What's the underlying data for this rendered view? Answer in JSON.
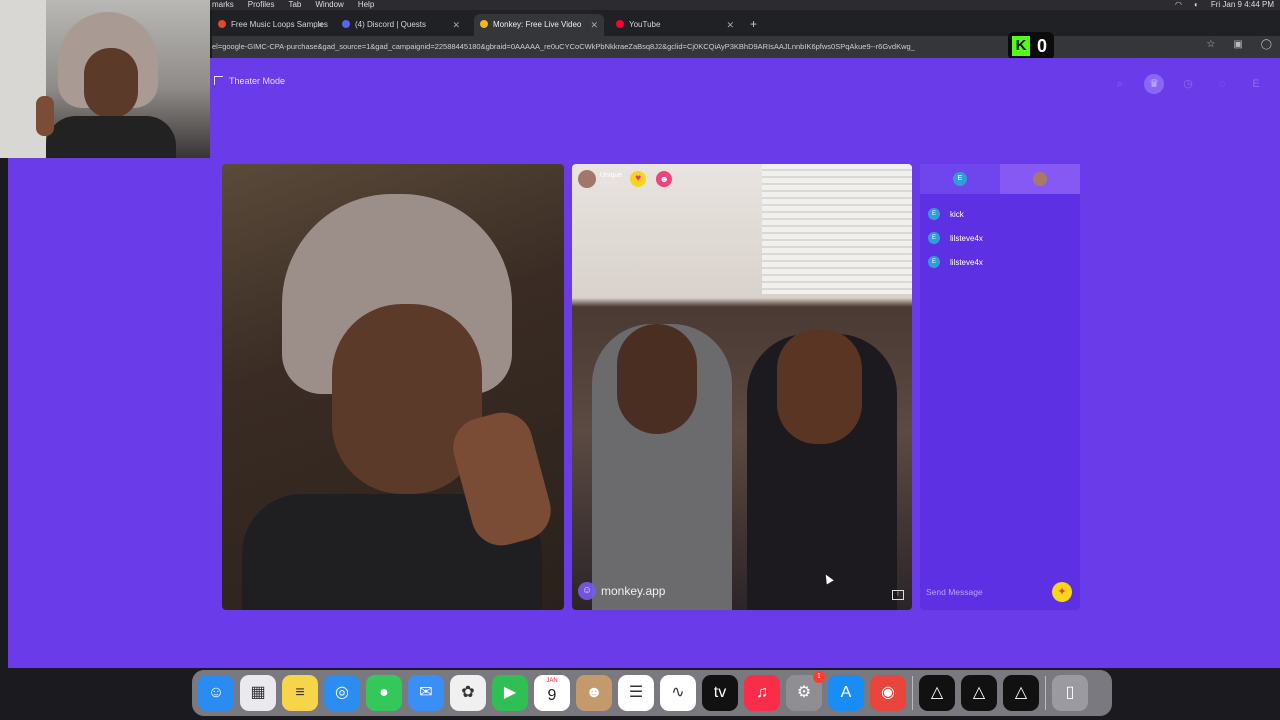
{
  "menubar": {
    "menus": [
      "marks",
      "Profiles",
      "Tab",
      "Window",
      "Help"
    ],
    "clock": "Fri Jan 9  4:44 PM"
  },
  "browser": {
    "tabs": [
      {
        "title": "Free Music Loops Samples S",
        "color": "#e0482f"
      },
      {
        "title": "(4) Discord | Quests",
        "color": "#5865f2"
      },
      {
        "title": "Monkey: Free Live Video",
        "color": "#f2b824"
      },
      {
        "title": "YouTube",
        "color": "#ff0033"
      }
    ],
    "new_tab": "+",
    "url": "el=google-GIMC-CPA-purchase&gad_source=1&gad_campaignid=22588445180&gbraid=0AAAAA_re0uCYCoCWkPbNkkraeZaBsq8J2&gclid=Cj0KCQiAyP3KBhD9ARIsAAJLnnbIK6pfws0SPqAkue9--r6GvdKwg_"
  },
  "kick_overlay": {
    "letter": "K",
    "count": "0"
  },
  "page": {
    "theater_label": "Theater Mode",
    "peer": {
      "name": "Unique",
      "location": "Florida"
    },
    "watermark": "monkey.app",
    "chat": {
      "tab_left_initial": "E",
      "messages": [
        {
          "initial": "E",
          "text": "kick"
        },
        {
          "initial": "E",
          "text": "lilsteve4x"
        },
        {
          "initial": "E",
          "text": "lilsteve4x"
        }
      ],
      "send_placeholder": "Send Message"
    }
  },
  "dock": {
    "items": [
      {
        "name": "finder",
        "glyph": "☺",
        "color": "#2a8cf0"
      },
      {
        "name": "launchpad",
        "glyph": "▦",
        "color": "#e9e9ee"
      },
      {
        "name": "notes",
        "glyph": "≡",
        "color": "#f7d54a"
      },
      {
        "name": "safari",
        "glyph": "◎",
        "color": "#2d8cf0"
      },
      {
        "name": "messages",
        "glyph": "●",
        "color": "#34c759"
      },
      {
        "name": "mail",
        "glyph": "✉",
        "color": "#3a8ef6"
      },
      {
        "name": "photos",
        "glyph": "✿",
        "color": "#f0f0f0"
      },
      {
        "name": "facetime",
        "glyph": "▶",
        "color": "#2fbf54"
      },
      {
        "name": "calendar",
        "glyph": "",
        "color": "#ffffff"
      },
      {
        "name": "contacts",
        "glyph": "☻",
        "color": "#c49a6c"
      },
      {
        "name": "reminders",
        "glyph": "☰",
        "color": "#ffffff"
      },
      {
        "name": "freeform",
        "glyph": "∿",
        "color": "#ffffff"
      },
      {
        "name": "apple-tv",
        "glyph": "tv",
        "color": "#111111"
      },
      {
        "name": "music",
        "glyph": "♫",
        "color": "#fa2d48"
      },
      {
        "name": "system-settings",
        "glyph": "⚙",
        "color": "#8e8e93"
      },
      {
        "name": "app-store",
        "glyph": "A",
        "color": "#1a8cf5"
      },
      {
        "name": "chrome",
        "glyph": "◉",
        "color": "#e8453c"
      },
      {
        "name": "app-a",
        "glyph": "△",
        "color": "#111111"
      },
      {
        "name": "app-b",
        "glyph": "△",
        "color": "#111111"
      },
      {
        "name": "app-c",
        "glyph": "△",
        "color": "#111111"
      },
      {
        "name": "trash",
        "glyph": "▯",
        "color": "#9a9aa0"
      }
    ],
    "calendar": {
      "month": "JAN",
      "day": "9"
    },
    "settings_badge": "1"
  }
}
